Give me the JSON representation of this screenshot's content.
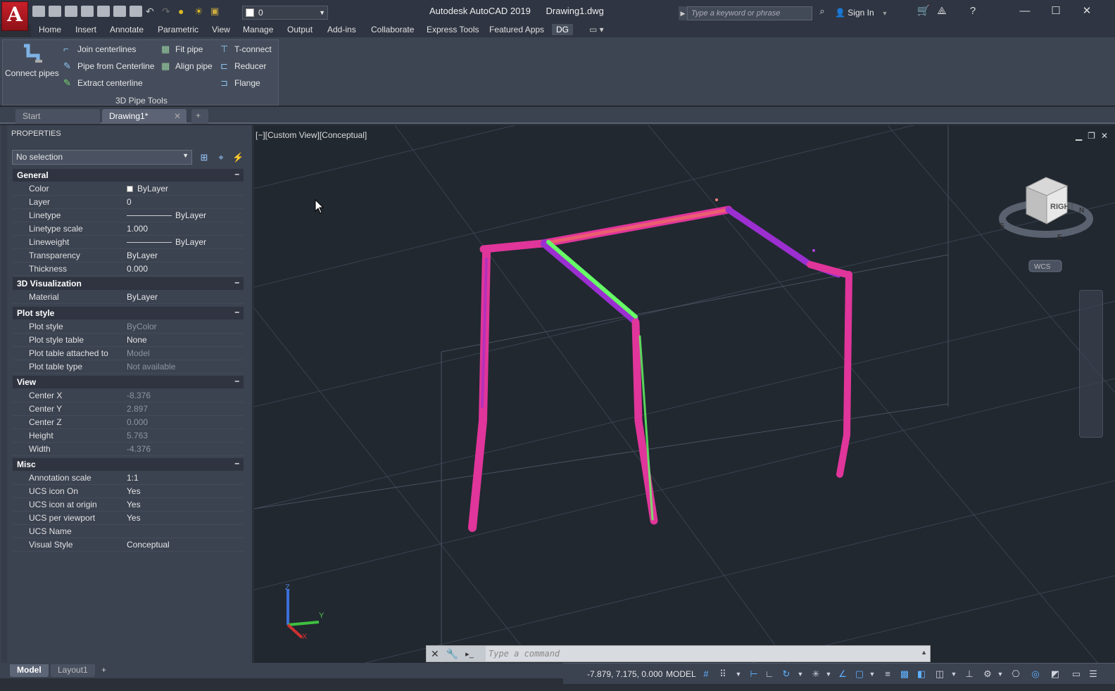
{
  "title_bar": {
    "app_name": "Autodesk AutoCAD 2019",
    "file_name": "Drawing1.dwg",
    "layer_value": "0",
    "search_placeholder": "Type a keyword or phrase",
    "sign_in": "Sign In"
  },
  "menu_tabs": [
    "Home",
    "Insert",
    "Annotate",
    "Parametric",
    "View",
    "Manage",
    "Output",
    "Add-ins",
    "Collaborate",
    "Express Tools",
    "Featured Apps",
    "DG"
  ],
  "active_tab": "DG",
  "ribbon": {
    "panel_title": "3D Pipe Tools",
    "connect_pipes": "Connect pipes",
    "join_centerlines": "Join centerlines",
    "pipe_from_centerline": "Pipe from Centerline",
    "extract_centerline": "Extract centerline",
    "fit_pipe": "Fit pipe",
    "align_pipe": "Align pipe",
    "t_connect": "T-connect",
    "reducer": "Reducer",
    "flange": "Flange"
  },
  "doc_tabs": {
    "start": "Start",
    "drawing": "Drawing1*"
  },
  "properties": {
    "title": "PROPERTIES",
    "selection": "No selection",
    "general": {
      "label": "General",
      "rows": [
        {
          "k": "Color",
          "v": "ByLayer"
        },
        {
          "k": "Layer",
          "v": "0"
        },
        {
          "k": "Linetype",
          "v": "ByLayer"
        },
        {
          "k": "Linetype scale",
          "v": "1.000"
        },
        {
          "k": "Lineweight",
          "v": "ByLayer"
        },
        {
          "k": "Transparency",
          "v": "ByLayer"
        },
        {
          "k": "Thickness",
          "v": "0.000"
        }
      ]
    },
    "viz": {
      "label": "3D Visualization",
      "rows": [
        {
          "k": "Material",
          "v": "ByLayer"
        }
      ]
    },
    "plot": {
      "label": "Plot style",
      "rows": [
        {
          "k": "Plot style",
          "v": "ByColor"
        },
        {
          "k": "Plot style table",
          "v": "None"
        },
        {
          "k": "Plot table attached to",
          "v": "Model"
        },
        {
          "k": "Plot table type",
          "v": "Not available"
        }
      ]
    },
    "view": {
      "label": "View",
      "rows": [
        {
          "k": "Center X",
          "v": "-8.376"
        },
        {
          "k": "Center Y",
          "v": "2.897"
        },
        {
          "k": "Center Z",
          "v": "0.000"
        },
        {
          "k": "Height",
          "v": "5.763"
        },
        {
          "k": "Width",
          "v": "-4.376"
        }
      ]
    },
    "misc": {
      "label": "Misc",
      "rows": [
        {
          "k": "Annotation scale",
          "v": "1:1"
        },
        {
          "k": "UCS icon On",
          "v": "Yes"
        },
        {
          "k": "UCS icon at origin",
          "v": "Yes"
        },
        {
          "k": "UCS per viewport",
          "v": "Yes"
        },
        {
          "k": "UCS Name",
          "v": ""
        },
        {
          "k": "Visual Style",
          "v": "Conceptual"
        }
      ]
    }
  },
  "viewport": {
    "label": "[−][Custom View][Conceptual]",
    "viewcube_face": "RIGHT",
    "wcs": "WCS",
    "compass": [
      "S",
      "N",
      "E"
    ],
    "ucs_axes": [
      "Z",
      "Y",
      "X"
    ]
  },
  "command": {
    "placeholder": "Type a command"
  },
  "layout_tabs": [
    "Model",
    "Layout1"
  ],
  "status": {
    "coords": "-7.879, 7.175, 0.000",
    "mode": "MODEL"
  },
  "colors": {
    "pipe_magenta": "#e0359a",
    "pipe_green": "#66ff66",
    "pipe_purple": "#9b2fd0",
    "viewport_bg": "#212830"
  }
}
